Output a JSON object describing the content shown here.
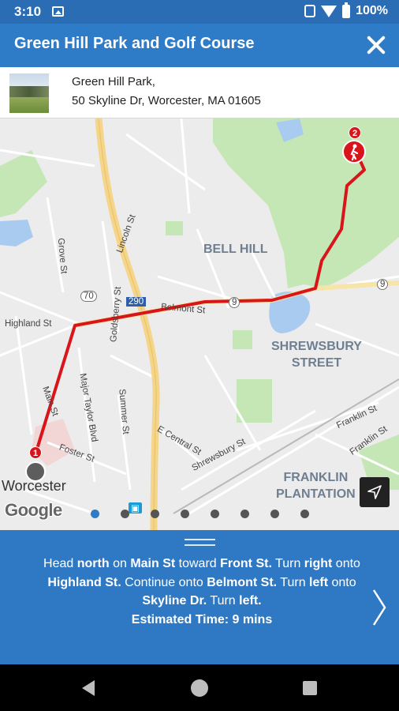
{
  "status_bar": {
    "time": "3:10",
    "battery": "100%"
  },
  "header": {
    "title": "Green Hill Park and Golf Course"
  },
  "destination": {
    "name": "Green Hill Park,",
    "address": "50 Skyline Dr, Worcester, MA 01605"
  },
  "map": {
    "areas": {
      "bell_hill": "BELL HILL",
      "shrewsbury_street": "SHREWSBURY\nSTREET",
      "franklin_plantation": "FRANKLIN\nPLANTATION"
    },
    "town": "Worcester",
    "streets": {
      "grove": "Grove St",
      "lincoln": "Lincoln St",
      "highland": "Highland St",
      "belmont": "Belmont St",
      "goldsberry": "Goldsberry St",
      "main": "Main St",
      "major_taylor": "Major Taylor Blvd",
      "summer": "Summer St",
      "foster": "Foster St",
      "e_central": "E Central St",
      "shrewsbury": "Shrewsbury St",
      "franklin_1": "Franklin St",
      "franklin_2": "Franklin St"
    },
    "shields": {
      "rt70": "70",
      "i290": "290",
      "rt9a": "9",
      "rt9b": "9"
    },
    "markers": {
      "start": "1",
      "end": "2"
    },
    "attribution": "Google",
    "pagination": {
      "total": 8,
      "active": 1
    }
  },
  "directions": {
    "segments": [
      {
        "t": "Head ",
        "b": false
      },
      {
        "t": "north",
        "b": true
      },
      {
        "t": " on ",
        "b": false
      },
      {
        "t": "Main St",
        "b": true
      },
      {
        "t": " toward ",
        "b": false
      },
      {
        "t": "Front St.",
        "b": true
      },
      {
        "t": " Turn ",
        "b": false
      },
      {
        "t": "right",
        "b": true
      },
      {
        "t": " onto ",
        "b": false
      },
      {
        "t": "Highland St.",
        "b": true
      },
      {
        "t": " Continue onto ",
        "b": false
      },
      {
        "t": "Belmont St.",
        "b": true
      },
      {
        "t": " Turn ",
        "b": false
      },
      {
        "t": "left",
        "b": true
      },
      {
        "t": " onto ",
        "b": false
      },
      {
        "t": "Skyline Dr.",
        "b": true
      },
      {
        "t": " Turn ",
        "b": false
      },
      {
        "t": "left.",
        "b": true
      }
    ],
    "estimated_time": "Estimated Time: 9 mins"
  },
  "colors": {
    "primary": "#2e7bc7",
    "route": "#d8151b",
    "park": "#c5e7b5",
    "water": "#a9cbf0",
    "highway": "#f5d58a"
  }
}
